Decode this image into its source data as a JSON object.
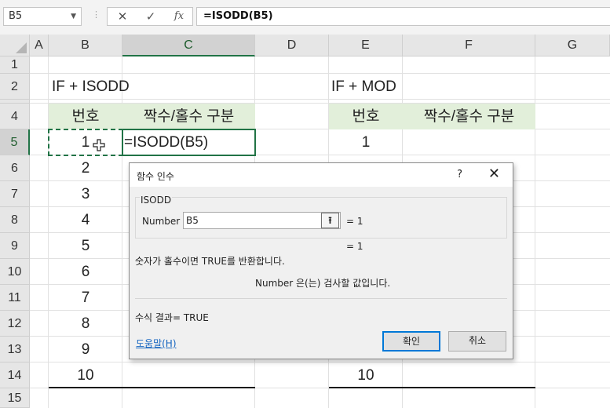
{
  "formula_bar": {
    "name_box": "B5",
    "cancel_icon": "✕",
    "enter_icon": "✓",
    "fx_label": "fx",
    "formula": "=ISODD(B5)"
  },
  "grid": {
    "columns": [
      "A",
      "B",
      "C",
      "D",
      "E",
      "F",
      "G"
    ],
    "rows": [
      "1",
      "2",
      "3",
      "4",
      "5",
      "6",
      "7",
      "8",
      "9",
      "10",
      "11",
      "12",
      "13",
      "14",
      "15"
    ]
  },
  "sheet": {
    "left_title": "IF +  ISODD",
    "right_title": "IF + MOD",
    "header_no": "번호",
    "header_type": "짝수/홀수 구분",
    "left_numbers": [
      "1",
      "2",
      "3",
      "4",
      "5",
      "6",
      "7",
      "8",
      "9",
      "10"
    ],
    "edit_formula": "=ISODD(B5)",
    "right_first": "1",
    "right_last": "10"
  },
  "dialog": {
    "title": "함수 인수",
    "help_icon": "?",
    "close_icon": "✕",
    "function_name": "ISODD",
    "arg_label": "Number",
    "arg_value": "B5",
    "arg_result_1": "=  1",
    "arg_result_2": "=  1",
    "description": "숫자가 홀수이면 TRUE를 반환합니다.",
    "arg_description": "Number  은(는) 검사할 값입니다.",
    "result": "수식 결과=  TRUE",
    "help_link": "도움말(H)",
    "ok": "확인",
    "cancel": "취소"
  },
  "colors": {
    "accent": "#217346",
    "header_fill": "#e2efda",
    "link": "#1565c0"
  }
}
